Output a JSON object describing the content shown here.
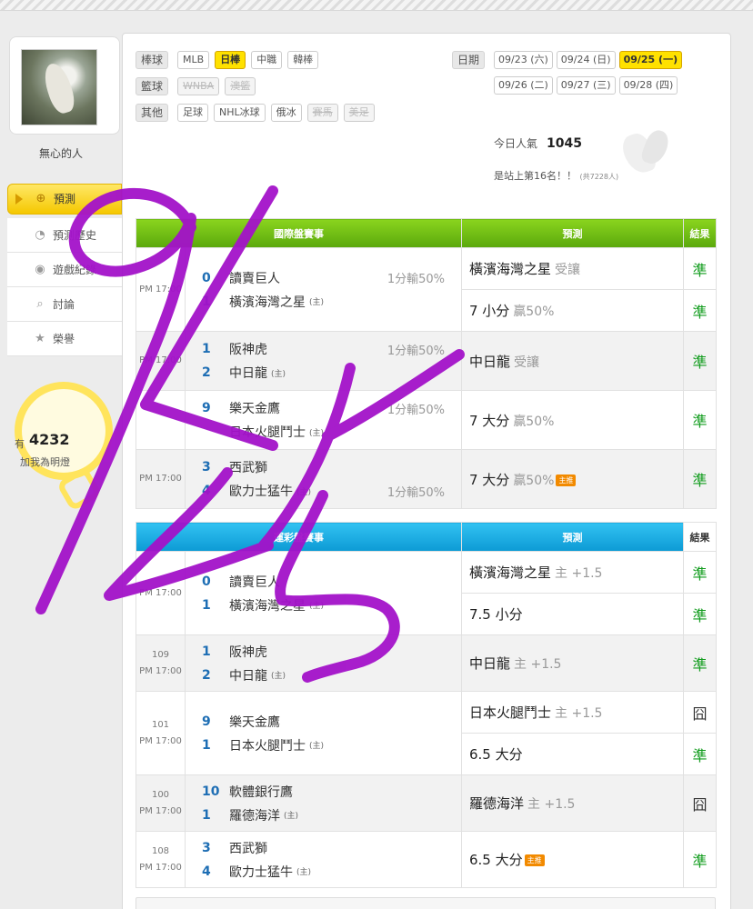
{
  "user": {
    "name": "無心的人"
  },
  "side_menu": [
    {
      "label": "預測",
      "icon": "target-icon",
      "active": true
    },
    {
      "label": "預測歷史",
      "icon": "history-icon",
      "active": false
    },
    {
      "label": "遊戲紀錄",
      "icon": "record-icon",
      "active": false
    },
    {
      "label": "討論",
      "icon": "discuss-icon",
      "active": false
    },
    {
      "label": "榮譽",
      "icon": "medal-icon",
      "active": false
    }
  ],
  "bulb": {
    "prefix": "有",
    "count": "4232",
    "text": "加我為明燈"
  },
  "filters": {
    "rows": [
      {
        "label": "棒球",
        "items": [
          {
            "text": "MLB",
            "state": "normal"
          },
          {
            "text": "日棒",
            "state": "selected"
          },
          {
            "text": "中職",
            "state": "normal"
          },
          {
            "text": "韓棒",
            "state": "normal"
          }
        ]
      },
      {
        "label": "籃球",
        "items": [
          {
            "text": "WNBA",
            "state": "disabled"
          },
          {
            "text": "澳籃",
            "state": "disabled"
          }
        ]
      },
      {
        "label": "其他",
        "items": [
          {
            "text": "足球",
            "state": "normal"
          },
          {
            "text": "NHL冰球",
            "state": "normal"
          },
          {
            "text": "俄冰",
            "state": "normal"
          },
          {
            "text": "賽馬",
            "state": "disabled"
          },
          {
            "text": "美足",
            "state": "disabled"
          }
        ]
      }
    ]
  },
  "dates": {
    "label": "日期",
    "rows": [
      [
        {
          "text": "09/23 (六)",
          "selected": false
        },
        {
          "text": "09/24 (日)",
          "selected": false
        },
        {
          "text": "09/25 (一)",
          "selected": true
        }
      ],
      [
        {
          "text": "09/26 (二)",
          "selected": false
        },
        {
          "text": "09/27 (三)",
          "selected": false
        },
        {
          "text": "09/28 (四)",
          "selected": false
        }
      ]
    ]
  },
  "stats": {
    "popularity_label": "今日人氣",
    "popularity_value": "1045",
    "rank_text": "是站上第16名！！",
    "rank_total": "(共7228人)"
  },
  "intl": {
    "header": {
      "games": "國際盤賽事",
      "prediction": "預測",
      "result": "結果"
    },
    "games": [
      {
        "id": "",
        "time": "PM 17:00",
        "teams": [
          {
            "score": "0",
            "name": "讀賣巨人",
            "host": "",
            "spread": "1分輸50%"
          },
          {
            "score": "1",
            "name": "橫濱海灣之星",
            "host": "(主)",
            "spread": ""
          }
        ],
        "picks": [
          {
            "main": "橫濱海灣之星",
            "sub": "受讓",
            "tag": "",
            "result": "準"
          },
          {
            "main": "7 小分",
            "sub": "贏50%",
            "tag": "",
            "result": "準"
          }
        ]
      },
      {
        "id": "",
        "time": "PM 17:00",
        "teams": [
          {
            "score": "1",
            "name": "阪神虎",
            "host": "",
            "spread": "1分輸50%"
          },
          {
            "score": "2",
            "name": "中日龍",
            "host": "(主)",
            "spread": ""
          }
        ],
        "picks": [
          {
            "main": "中日龍",
            "sub": "受讓",
            "tag": "",
            "result": "準"
          }
        ]
      },
      {
        "id": "",
        "time": "",
        "teams": [
          {
            "score": "9",
            "name": "樂天金鷹",
            "host": "",
            "spread": "1分輸50%"
          },
          {
            "score": "",
            "name": "日本火腿鬥士",
            "host": "(主)",
            "spread": ""
          }
        ],
        "picks": [
          {
            "main": "7 大分",
            "sub": "贏50%",
            "tag": "",
            "result": "準"
          }
        ]
      },
      {
        "id": "",
        "time": "PM 17:00",
        "teams": [
          {
            "score": "3",
            "name": "西武獅",
            "host": "",
            "spread": ""
          },
          {
            "score": "4",
            "name": "歐力士猛牛",
            "host": "(主)",
            "spread": "1分輸50%"
          }
        ],
        "picks": [
          {
            "main": "7 大分",
            "sub": "贏50%",
            "tag": "主推",
            "result": "準"
          }
        ]
      }
    ]
  },
  "lottery": {
    "header": {
      "games": "運彩盤賽事",
      "prediction": "預測",
      "result": "結果"
    },
    "games": [
      {
        "id": "",
        "time": "PM 17:00",
        "teams": [
          {
            "score": "0",
            "name": "讀賣巨人",
            "host": ""
          },
          {
            "score": "1",
            "name": "橫濱海灣之星",
            "host": "(主)"
          }
        ],
        "picks": [
          {
            "main": "橫濱海灣之星",
            "sub": "主 +1.5",
            "tag": "",
            "result": "準"
          },
          {
            "main": "7.5 小分",
            "sub": "",
            "tag": "",
            "result": "準"
          }
        ]
      },
      {
        "id": "109",
        "time": "PM 17:00",
        "teams": [
          {
            "score": "1",
            "name": "阪神虎",
            "host": ""
          },
          {
            "score": "2",
            "name": "中日龍",
            "host": "(主)"
          }
        ],
        "picks": [
          {
            "main": "中日龍",
            "sub": "主 +1.5",
            "tag": "",
            "result": "準"
          }
        ]
      },
      {
        "id": "101",
        "time": "PM 17:00",
        "teams": [
          {
            "score": "9",
            "name": "樂天金鷹",
            "host": ""
          },
          {
            "score": "1",
            "name": "日本火腿鬥士",
            "host": "(主)"
          }
        ],
        "picks": [
          {
            "main": "日本火腿鬥士",
            "sub": "主 +1.5",
            "tag": "",
            "result": "囧"
          },
          {
            "main": "6.5 大分",
            "sub": "",
            "tag": "",
            "result": "準"
          }
        ]
      },
      {
        "id": "100",
        "time": "PM 17:00",
        "teams": [
          {
            "score": "10",
            "name": "軟體銀行鷹",
            "host": ""
          },
          {
            "score": "1",
            "name": "羅德海洋",
            "host": "(主)"
          }
        ],
        "picks": [
          {
            "main": "羅德海洋",
            "sub": "主 +1.5",
            "tag": "",
            "result": "囧"
          }
        ]
      },
      {
        "id": "108",
        "time": "PM 17:00",
        "teams": [
          {
            "score": "3",
            "name": "西武獅",
            "host": ""
          },
          {
            "score": "4",
            "name": "歐力士猛牛",
            "host": "(主)"
          }
        ],
        "picks": [
          {
            "main": "6.5 大分",
            "sub": "",
            "tag": "主推",
            "result": "準"
          }
        ]
      }
    ]
  },
  "colors": {
    "accent_yellow": "#ffe100",
    "intl_header": "#6cbc14",
    "lottery_header": "#1aaee4",
    "win": "#119c1d",
    "scribble": "#a312c9"
  }
}
